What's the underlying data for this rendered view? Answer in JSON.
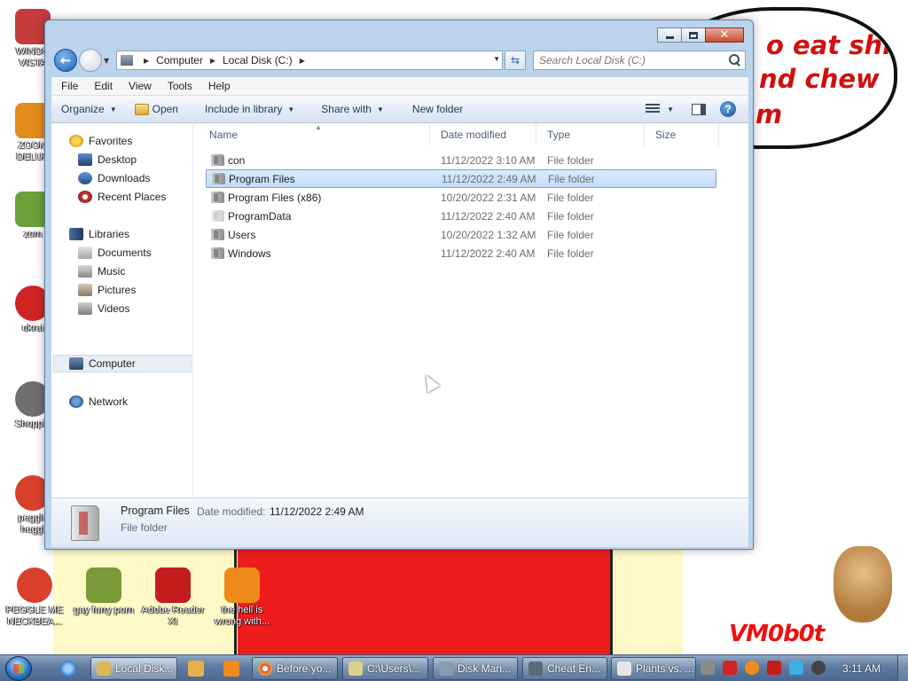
{
  "desktop": {
    "speech_lines": [
      "o eat shit",
      "nd chew",
      "m"
    ],
    "watermark": "VM0b0t",
    "icons_left": [
      {
        "label": "WINDO\nVISTA",
        "icon": "windows-vista-icon",
        "color": "#c63b3b"
      },
      {
        "label": "ZOOM\nDELUX",
        "icon": "zoom-deluxe-icon",
        "color": "#e28c1a"
      },
      {
        "label": "zom",
        "icon": "zombie-icon",
        "color": "#6aa13a"
      },
      {
        "label": "ukrai",
        "icon": "radiation-icon",
        "color": "#d02424"
      },
      {
        "label": "Shoppin",
        "icon": "flash-icon",
        "color": "#6f6f6f"
      },
      {
        "label": "peggle\nheggl",
        "icon": "peggle-icon",
        "color": "#d8402c"
      }
    ],
    "icons_bottom": [
      {
        "label": "PEGGLE ME NECKBEA...",
        "icon": "peggle-icon",
        "color": "#d8402c"
      },
      {
        "label": "gay furry porn",
        "icon": "box-hamster-icon",
        "color": "#7a9a3a"
      },
      {
        "label": "Adobe Reader XI",
        "icon": "adobe-reader-icon",
        "color": "#c41d1d"
      },
      {
        "label": "the hell is wrong with...",
        "icon": "uc-browser-icon",
        "color": "#f08a1a"
      }
    ]
  },
  "window": {
    "address": {
      "segments": [
        "Computer",
        "Local Disk (C:)"
      ]
    },
    "search": {
      "placeholder": "Search Local Disk (C:)"
    },
    "menu": [
      "File",
      "Edit",
      "View",
      "Tools",
      "Help"
    ],
    "toolbar": {
      "organize": "Organize",
      "open": "Open",
      "include_in_library": "Include in library",
      "share_with": "Share with",
      "new_folder": "New folder"
    },
    "navpane": {
      "favorites": "Favorites",
      "desktop": "Desktop",
      "downloads": "Downloads",
      "recent_places": "Recent Places",
      "libraries": "Libraries",
      "documents": "Documents",
      "music": "Music",
      "pictures": "Pictures",
      "videos": "Videos",
      "computer": "Computer",
      "network": "Network"
    },
    "columns": {
      "name": "Name",
      "date": "Date modified",
      "type": "Type",
      "size": "Size"
    },
    "files": [
      {
        "name": "con",
        "date": "11/12/2022 3:10 AM",
        "type": "File folder"
      },
      {
        "name": "Program Files",
        "date": "11/12/2022 2:49 AM",
        "type": "File folder",
        "selected": true
      },
      {
        "name": "Program Files (x86)",
        "date": "10/20/2022 2:31 AM",
        "type": "File folder"
      },
      {
        "name": "ProgramData",
        "date": "11/12/2022 2:40 AM",
        "type": "File folder",
        "hidden": true
      },
      {
        "name": "Users",
        "date": "10/20/2022 1:32 AM",
        "type": "File folder"
      },
      {
        "name": "Windows",
        "date": "11/12/2022 2:40 AM",
        "type": "File folder"
      }
    ],
    "details": {
      "name": "Program Files",
      "date_label": "Date modified:",
      "date": "11/12/2022 2:49 AM",
      "type": "File folder"
    }
  },
  "taskbar": {
    "buttons": [
      {
        "label": "Local Disk...",
        "icon": "explorer-icon",
        "color": "#d9b75a",
        "active": true
      },
      {
        "label": "Before yo...",
        "icon": "chrome-icon",
        "color": "#e2463a"
      },
      {
        "label": "C:\\Users\\...",
        "icon": "notepad-icon",
        "color": "#dcd08a"
      },
      {
        "label": "Disk Man...",
        "icon": "disk-management-icon",
        "color": "#8a9bb0"
      },
      {
        "label": "Cheat En...",
        "icon": "cheat-engine-icon",
        "color": "#5a6a7a"
      },
      {
        "label": "Plants vs. ...",
        "icon": "plants-vs-zombies-icon",
        "color": "#e6e6e6"
      }
    ],
    "clock": "3:11 AM"
  },
  "colors": {
    "accent": "#1d5fb6",
    "selection": "#c1dbfc",
    "wallpaper_red": "#ee1c1c",
    "wallpaper_yellow": "#fff9c8"
  }
}
